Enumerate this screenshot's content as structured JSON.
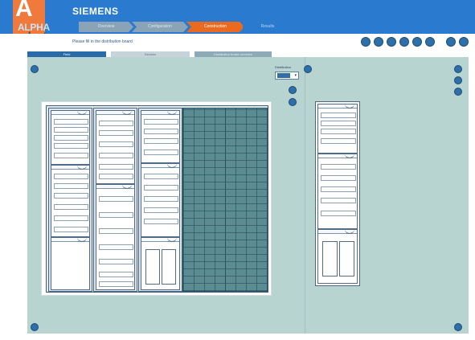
{
  "header": {
    "brand": "SIEMENS",
    "logo": {
      "letter": "A",
      "line1": "ALPHA",
      "line2": "select"
    },
    "steps": [
      {
        "label": "Overview",
        "state": "done"
      },
      {
        "label": "Configuration",
        "state": "done"
      },
      {
        "label": "Construction",
        "state": "active"
      },
      {
        "label": "Results",
        "state": "todo"
      }
    ],
    "accent_color": "#2a7bd0",
    "active_step_color": "#ea6a1f"
  },
  "subbar": {
    "hint": "Please fill in the distribution board",
    "toolbar_icons": [
      "undo-icon",
      "redo-icon",
      "zoom-in-icon",
      "zoom-out-icon",
      "print-icon",
      "settings-icon",
      "help-icon",
      "info-icon"
    ]
  },
  "tabs": [
    {
      "label": "Field",
      "active": true
    },
    {
      "label": "Devices",
      "active": false
    },
    {
      "label": "Distribution board overview",
      "active": false
    }
  ],
  "distribution": {
    "label": "Distribution",
    "selected_value": "1"
  }
}
